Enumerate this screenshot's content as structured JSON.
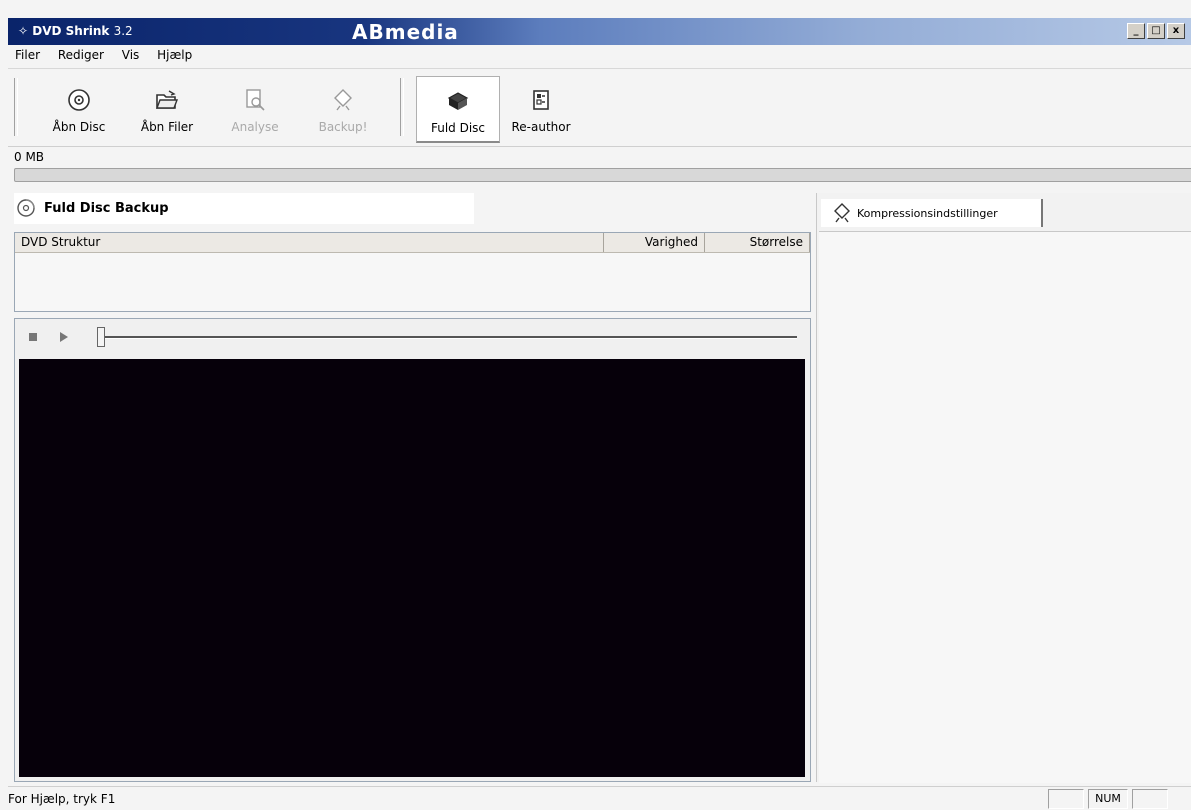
{
  "titlebar": {
    "app_name": "DVD Shrink",
    "version": "3.2",
    "brand": "ABmedia",
    "min_glyph": "_",
    "max_glyph": "□",
    "close_glyph": "x"
  },
  "menu": {
    "items": [
      {
        "label": "Filer"
      },
      {
        "label": "Rediger"
      },
      {
        "label": "Vis"
      },
      {
        "label": "Hjælp"
      }
    ]
  },
  "toolbar": {
    "buttons": [
      {
        "label": "Åbn Disc",
        "icon": "disc-icon",
        "enabled": true
      },
      {
        "label": "Åbn Filer",
        "icon": "open-folder-icon",
        "enabled": true
      },
      {
        "label": "Analyse",
        "icon": "analyse-icon",
        "enabled": false
      },
      {
        "label": "Backup!",
        "icon": "backup-icon",
        "enabled": false
      },
      {
        "label": "Fuld Disc",
        "icon": "full-disc-icon",
        "enabled": true,
        "active": true
      },
      {
        "label": "Re-author",
        "icon": "re-author-icon",
        "enabled": true
      }
    ]
  },
  "sizebar": {
    "label": "0 MB",
    "fill_fraction": 0
  },
  "left_panel": {
    "tab_title": "Fuld Disc Backup",
    "table": {
      "columns": [
        {
          "label": "DVD Struktur"
        },
        {
          "label": "Varighed"
        },
        {
          "label": "Størrelse"
        }
      ],
      "rows": []
    }
  },
  "player": {
    "seek_fraction": 0
  },
  "right_panel": {
    "tab_title": "Kompressionsindstillinger"
  },
  "statusbar": {
    "text": "For Hjælp, tryk F1",
    "num": "NUM"
  },
  "colors": {
    "title_dark": "#0a246a",
    "title_light": "#b6c9e6",
    "video_bg": "#06000a",
    "window_bg": "#f4f4f4"
  }
}
